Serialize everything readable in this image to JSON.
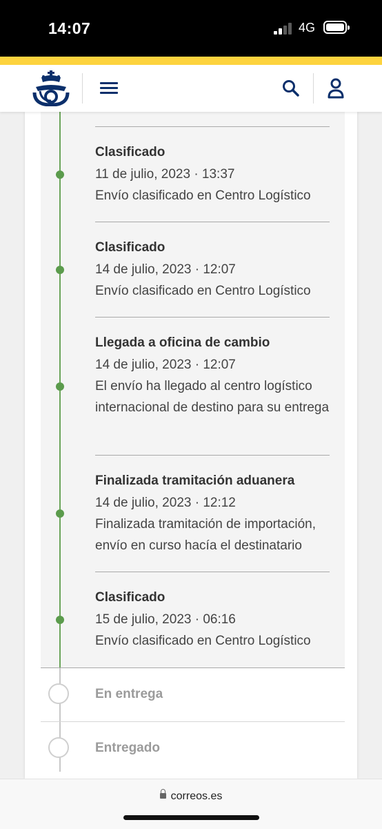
{
  "status_bar": {
    "time": "14:07",
    "network": "4G"
  },
  "header": {
    "logo_icon": "correos-horn-crown-logo",
    "menu_icon": "hamburger-menu-icon",
    "search_icon": "search-icon",
    "user_icon": "user-icon",
    "brand_color": "#0b2f6b",
    "accent_color": "#fdd33e"
  },
  "timeline": {
    "events": [
      {
        "title": "Clasificado",
        "date": "11 de julio, 2023 · 13:37",
        "description": "Envío clasificado en Centro Logístico"
      },
      {
        "title": "Clasificado",
        "date": "14 de julio, 2023 · 12:07",
        "description": "Envío clasificado en Centro Logístico"
      },
      {
        "title": "Llegada a oficina de cambio",
        "date": "14 de julio, 2023 · 12:07",
        "description": "El envío ha llegado al centro logístico internacional de destino para su entrega"
      },
      {
        "title": "Finalizada tramitación aduanera",
        "date": "14 de julio, 2023 · 12:12",
        "description": "Finalizada tramitación de importación, envío en curso hacía el destinatario"
      },
      {
        "title": "Clasificado",
        "date": "15 de julio, 2023 · 06:16",
        "description": "Envío clasificado en Centro Logístico"
      }
    ],
    "pending_steps": [
      {
        "title": "En entrega"
      },
      {
        "title": "Entregado"
      }
    ],
    "completed_color": "#5b9b4c",
    "pending_color": "#cfcfcf"
  },
  "browser": {
    "url": "correos.es"
  }
}
